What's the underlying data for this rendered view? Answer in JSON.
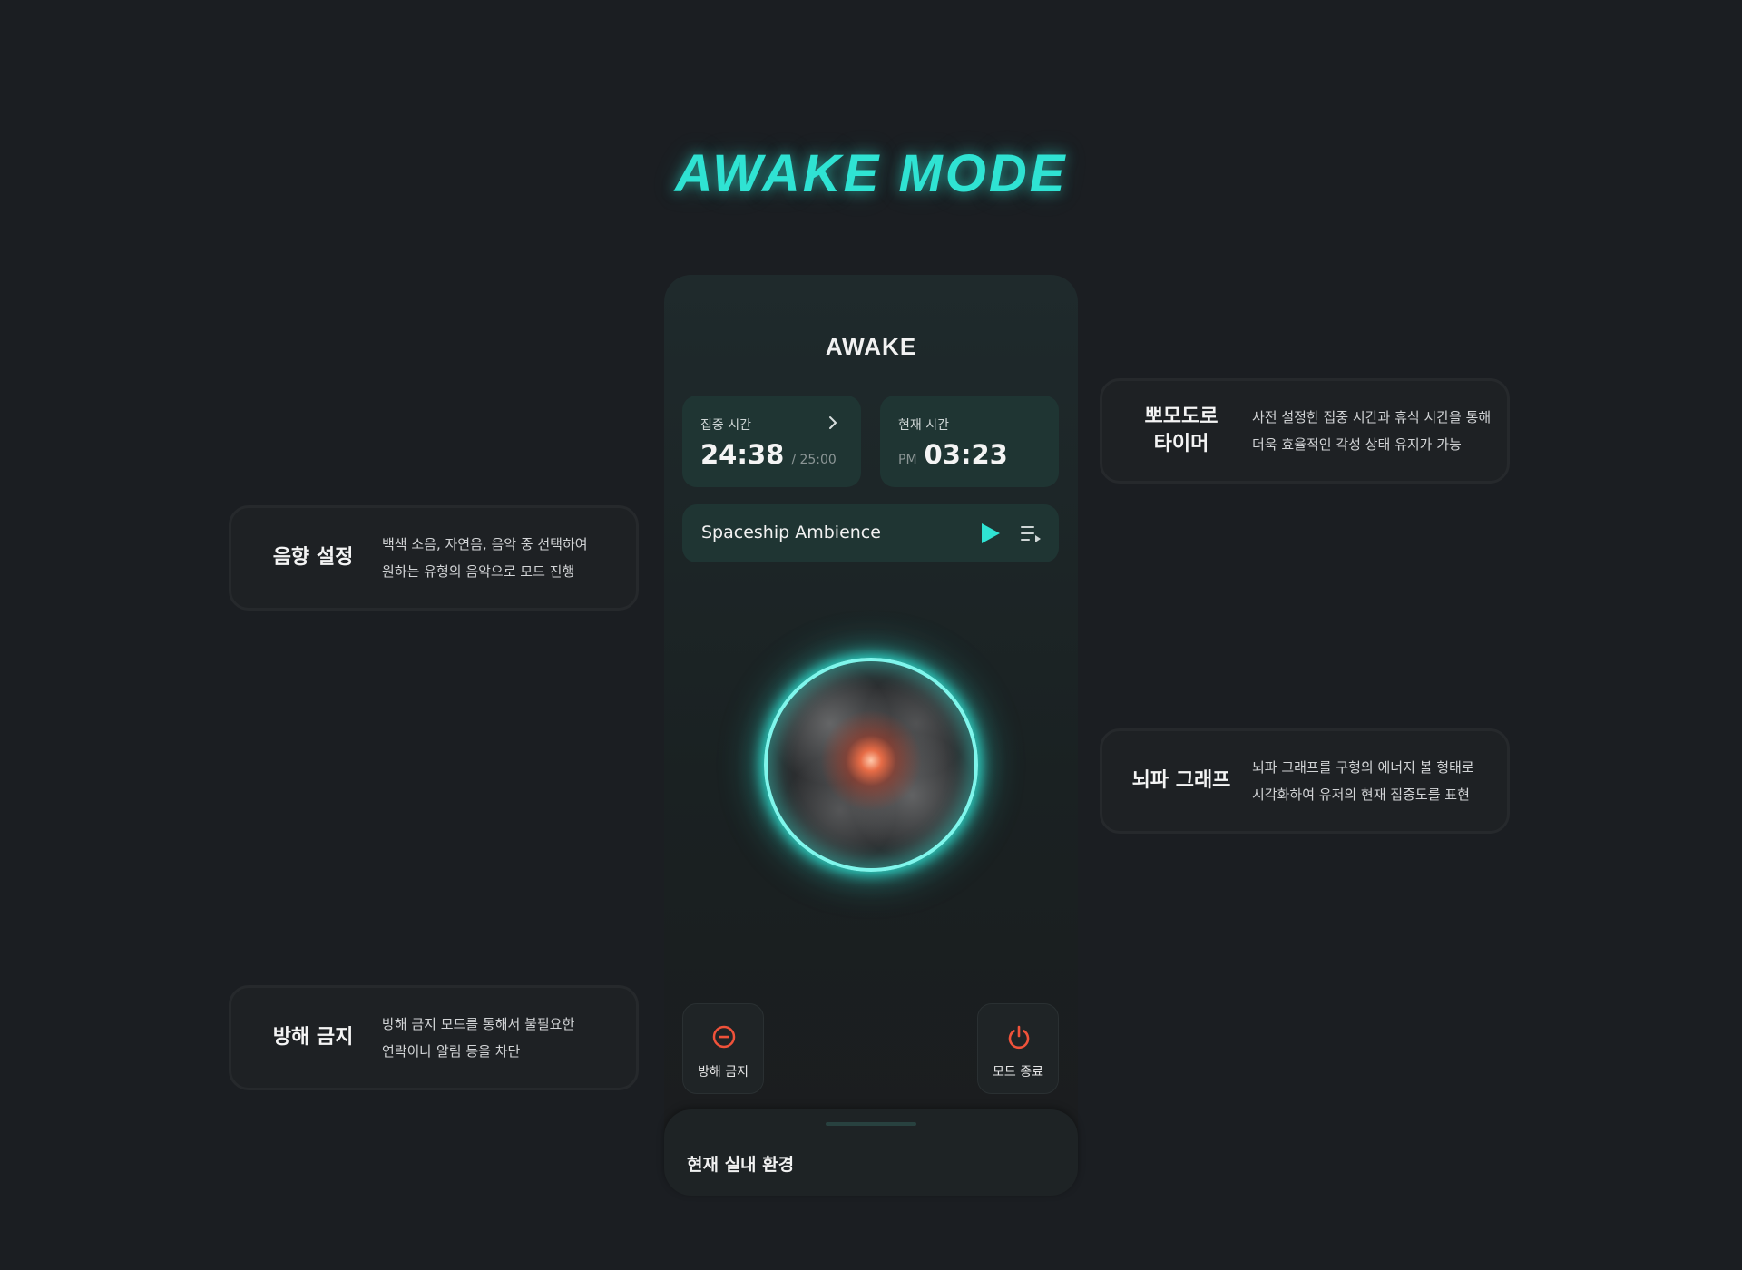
{
  "hero": {
    "title": "AWAKE MODE"
  },
  "app": {
    "logo": "AWAKE",
    "focus_time": {
      "label": "집중 시간",
      "value": "24:38",
      "total": "/ 25:00"
    },
    "current_time": {
      "label": "현재 시간",
      "ampm": "PM",
      "value": "03:23"
    },
    "music": {
      "title": "Spaceship Ambience"
    },
    "actions": {
      "dnd_label": "방해 금지",
      "end_label": "모드 종료"
    },
    "bottom_sheet": {
      "title": "현재 실내 환경"
    },
    "colors": {
      "accent": "#2fe3d3",
      "danger": "#f0523a",
      "card": "#1f3533",
      "background": "#1b1e22"
    }
  },
  "features": {
    "pomodoro": {
      "title": "뽀모도로\n타이머",
      "desc": "사전 설정한 집중 시간과 휴식 시간을 통해\n더욱 효율적인 각성 상태 유지가 가능"
    },
    "sound": {
      "title": "음향 설정",
      "desc": "백색 소음, 자연음, 음악 중 선택하여\n원하는 유형의 음악으로 모드 진행"
    },
    "brainwave": {
      "title": "뇌파 그래프",
      "desc": "뇌파 그래프를 구형의 에너지 볼 형태로\n시각화하여 유저의 현재 집중도를 표현"
    },
    "dnd": {
      "title": "방해 금지",
      "desc": "방해 금지 모드를 통해서 불필요한\n연락이나 알림 등을 차단"
    }
  },
  "icons": [
    "chevron-right-icon",
    "play-icon",
    "playlist-icon",
    "do-not-disturb-icon",
    "power-icon"
  ]
}
